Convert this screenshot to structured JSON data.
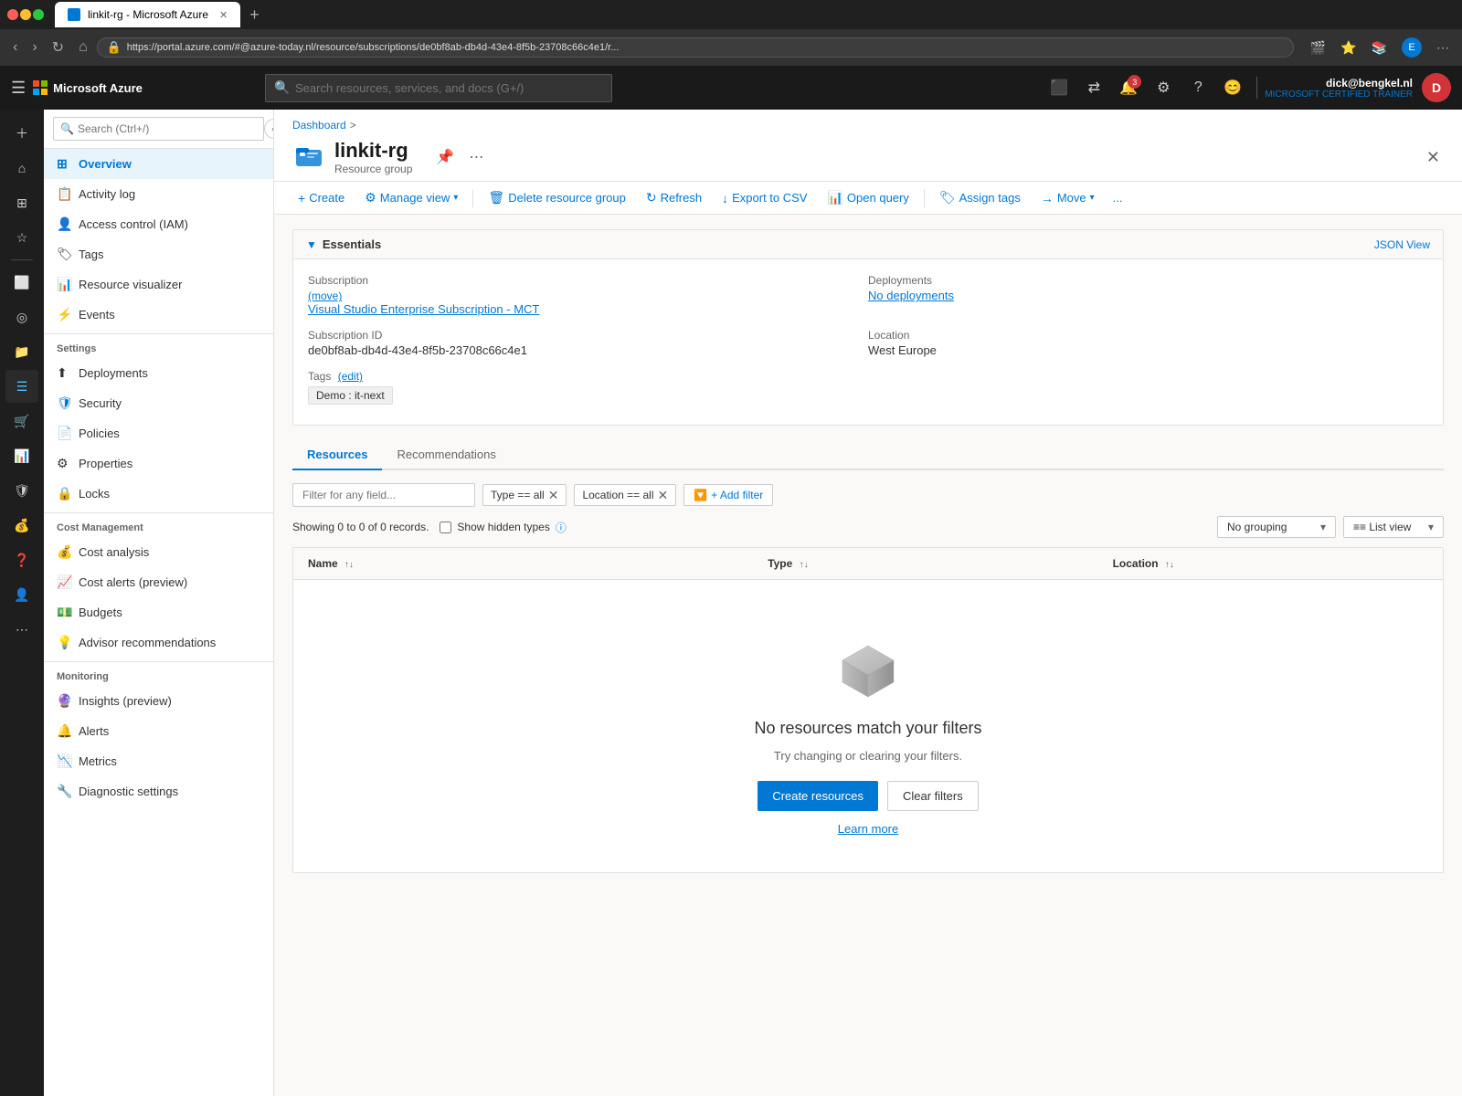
{
  "browser": {
    "tab_title": "linkit-rg - Microsoft Azure",
    "url": "https://portal.azure.com/#@azure-today.nl/resource/subscriptions/de0bf8ab-db4d-43e4-8f5b-23708c66c4e1/r...",
    "new_tab_label": "+"
  },
  "global_header": {
    "brand": "Microsoft Azure",
    "search_placeholder": "Search resources, services, and docs (G+/)",
    "hamburger_icon": "☰",
    "notification_count": "3",
    "user_name": "dick@bengkel.nl",
    "user_role": "MICROSOFT CERTIFIED TRAINER",
    "user_initials": "D"
  },
  "sidebar": {
    "search_placeholder": "Search (Ctrl+/)",
    "collapse_label": "«",
    "items": [
      {
        "label": "Overview",
        "icon": "⊞",
        "active": true
      },
      {
        "label": "Activity log",
        "icon": "📋"
      },
      {
        "label": "Access control (IAM)",
        "icon": "👤"
      },
      {
        "label": "Tags",
        "icon": "🏷"
      },
      {
        "label": "Resource visualizer",
        "icon": "📊"
      },
      {
        "label": "Events",
        "icon": "⚡"
      }
    ],
    "sections": [
      {
        "label": "Settings",
        "items": [
          {
            "label": "Deployments",
            "icon": "⬆"
          },
          {
            "label": "Security",
            "icon": "🛡"
          },
          {
            "label": "Policies",
            "icon": "📄"
          },
          {
            "label": "Properties",
            "icon": "⚙"
          },
          {
            "label": "Locks",
            "icon": "🔒"
          }
        ]
      },
      {
        "label": "Cost Management",
        "items": [
          {
            "label": "Cost analysis",
            "icon": "💰"
          },
          {
            "label": "Cost alerts (preview)",
            "icon": "📈"
          },
          {
            "label": "Budgets",
            "icon": "💵"
          },
          {
            "label": "Advisor recommendations",
            "icon": "💡"
          }
        ]
      },
      {
        "label": "Monitoring",
        "items": [
          {
            "label": "Insights (preview)",
            "icon": "🔮"
          },
          {
            "label": "Alerts",
            "icon": "🔔"
          },
          {
            "label": "Metrics",
            "icon": "📉"
          },
          {
            "label": "Diagnostic settings",
            "icon": "🔧"
          }
        ]
      }
    ]
  },
  "resource": {
    "breadcrumb": "Dashboard",
    "breadcrumb_separator": ">",
    "name": "linkit-rg",
    "subtitle": "Resource group",
    "pin_title": "Pin",
    "more_title": "More"
  },
  "command_bar": {
    "create_label": "Create",
    "manage_view_label": "Manage view",
    "delete_label": "Delete resource group",
    "refresh_label": "Refresh",
    "export_label": "Export to CSV",
    "open_query_label": "Open query",
    "assign_tags_label": "Assign tags",
    "move_label": "Move",
    "more_label": "..."
  },
  "essentials": {
    "section_title": "Essentials",
    "json_view_label": "JSON View",
    "subscription_label": "Subscription",
    "subscription_move": "(move)",
    "subscription_value": "Visual Studio Enterprise Subscription - MCT",
    "subscription_id_label": "Subscription ID",
    "subscription_id_value": "de0bf8ab-db4d-43e4-8f5b-23708c66c4e1",
    "tags_label": "Tags",
    "tags_edit": "(edit)",
    "tag_value": "Demo : it-next",
    "deployments_label": "Deployments",
    "deployments_value": "No deployments",
    "location_label": "Location",
    "location_value": "West Europe"
  },
  "tabs": [
    {
      "label": "Resources",
      "active": true
    },
    {
      "label": "Recommendations",
      "active": false
    }
  ],
  "filter_bar": {
    "placeholder": "Filter for any field...",
    "type_filter": "Type == all",
    "location_filter": "Location == all",
    "add_filter_label": "+ Add filter",
    "add_filter_icon": "🔽"
  },
  "records_bar": {
    "showing_text": "Showing 0 to 0 of 0 records.",
    "show_hidden_label": "Show hidden types",
    "no_grouping_label": "No grouping",
    "list_view_label": "≡≡ List view"
  },
  "table": {
    "columns": [
      {
        "label": "Name",
        "sort": "↑↓"
      },
      {
        "label": "Type",
        "sort": "↑↓"
      },
      {
        "label": "Location",
        "sort": "↑↓"
      }
    ],
    "rows": []
  },
  "empty_state": {
    "title": "No resources match your filters",
    "subtitle": "Try changing or clearing your filters.",
    "create_label": "Create resources",
    "clear_label": "Clear filters",
    "learn_more_label": "Learn more"
  },
  "icon_rail": {
    "items": [
      {
        "icon": "☰",
        "label": "menu"
      },
      {
        "icon": "+",
        "label": "create"
      },
      {
        "icon": "🏠",
        "label": "home"
      },
      {
        "icon": "⊞",
        "label": "dashboard"
      },
      {
        "icon": "☆",
        "label": "favorites"
      },
      {
        "icon": "⚡",
        "label": "recent"
      },
      {
        "icon": "📦",
        "label": "resources"
      },
      {
        "icon": "🔔",
        "label": "notifications"
      },
      {
        "icon": "⚙",
        "label": "settings"
      },
      {
        "icon": "🔀",
        "label": "switch"
      }
    ]
  },
  "colors": {
    "azure_blue": "#0078d4",
    "brand_dark": "#1a1a1a",
    "success": "#107c10",
    "danger": "#d13438"
  }
}
